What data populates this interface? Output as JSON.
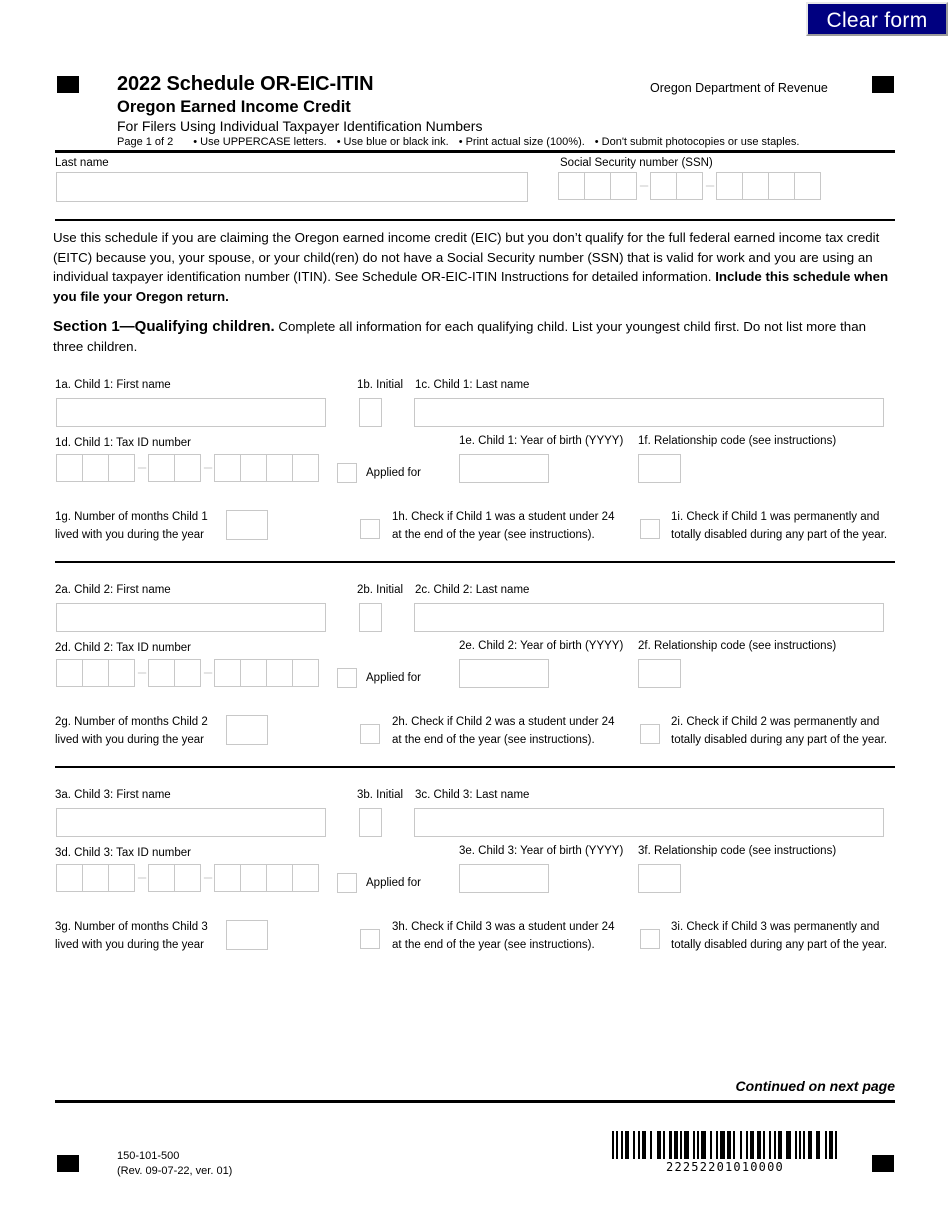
{
  "toolbar": {
    "clear_form_label": "Clear form",
    "clear_form_bg": "#000080",
    "clear_form_text_color": "#ffffff"
  },
  "header": {
    "title": "2022 Schedule OR-EIC-ITIN",
    "subtitle": "Oregon Earned Income Credit",
    "description": "For Filers Using Individual Taxpayer Identification Numbers",
    "agency": "Oregon Department of Revenue",
    "page_indicator": "Page 1 of 2",
    "instructions": [
      "Use UPPERCASE letters.",
      "Use blue or black ink.",
      "Print actual size (100%).",
      "Don't submit photocopies or use staples."
    ],
    "bullet": "•"
  },
  "taxpayer": {
    "last_name_label": "Last name",
    "last_name_value": "",
    "ssn_label": "Social Security number (SSN)",
    "ssn_groups": [
      3,
      2,
      4
    ],
    "ssn_separator": "–"
  },
  "intro": {
    "paragraph": "Use this schedule if you are claiming the Oregon earned income credit (EIC) but you don’t qualify for the full federal earned income tax credit (EITC) because you, your spouse, or your child(ren) do not have a Social Security number (SSN) that is valid for work and you are using an individual taxpayer identification number (ITIN). See Schedule OR-EIC-ITIN Instructions for detailed information.",
    "paragraph_bold": "Include this schedule when you file your Oregon return."
  },
  "section1": {
    "heading": "Section 1—Qualifying children.",
    "body": "Complete all information for each qualifying child. List your youngest child first. Do not list more than three children."
  },
  "children": [
    {
      "first_name_label": "1a. Child 1: First name",
      "first_name_value": "",
      "initial_label": "1b. Initial",
      "initial_value": "",
      "last_name_label": "1c. Child 1: Last name",
      "last_name_value": "",
      "tax_id_label": "1d. Child 1: Tax ID number",
      "tax_id_groups": [
        3,
        2,
        4
      ],
      "tax_id_separator": "–",
      "applied_for_label": "Applied for",
      "applied_for_checked": false,
      "year_of_birth_label": "1e. Child 1: Year of birth (YYYY)",
      "year_of_birth_value": "",
      "relationship_label": "1f. Relationship code (see instructions)",
      "relationship_value": "",
      "months_label_line1": "1g. Number of months Child 1",
      "months_label_line2": "lived with you during the year",
      "months_value": "",
      "student_label_line1": "1h. Check if Child 1 was a student under 24",
      "student_label_line2": "at the end of the year (see instructions).",
      "student_checked": false,
      "disabled_label_line1": "1i. Check if Child 1 was permanently and",
      "disabled_label_line2": "totally disabled during any part of the year.",
      "disabled_checked": false
    },
    {
      "first_name_label": "2a. Child 2: First name",
      "first_name_value": "",
      "initial_label": "2b. Initial",
      "initial_value": "",
      "last_name_label": "2c. Child 2: Last name",
      "last_name_value": "",
      "tax_id_label": "2d. Child 2: Tax ID number",
      "tax_id_groups": [
        3,
        2,
        4
      ],
      "tax_id_separator": "–",
      "applied_for_label": "Applied for",
      "applied_for_checked": false,
      "year_of_birth_label": "2e. Child 2: Year of birth (YYYY)",
      "year_of_birth_value": "",
      "relationship_label": "2f. Relationship code (see instructions)",
      "relationship_value": "",
      "months_label_line1": "2g. Number of months Child 2",
      "months_label_line2": "lived with you during the year",
      "months_value": "",
      "student_label_line1": "2h. Check if Child 2 was a student under 24",
      "student_label_line2": "at the end of the year (see instructions).",
      "student_checked": false,
      "disabled_label_line1": "2i. Check if Child 2 was permanently and",
      "disabled_label_line2": "totally disabled during any part of the year.",
      "disabled_checked": false
    },
    {
      "first_name_label": "3a. Child 3: First name",
      "first_name_value": "",
      "initial_label": "3b. Initial",
      "initial_value": "",
      "last_name_label": "3c. Child 3: Last name",
      "last_name_value": "",
      "tax_id_label": "3d. Child 3: Tax ID number",
      "tax_id_groups": [
        3,
        2,
        4
      ],
      "tax_id_separator": "–",
      "applied_for_label": "Applied for",
      "applied_for_checked": false,
      "year_of_birth_label": "3e. Child 3: Year of birth (YYYY)",
      "year_of_birth_value": "",
      "relationship_label": "3f. Relationship code (see instructions)",
      "relationship_value": "",
      "months_label_line1": "3g. Number of months Child 3",
      "months_label_line2": "lived with you during the year",
      "months_value": "",
      "student_label_line1": "3h. Check if Child 3 was a student under 24",
      "student_label_line2": "at the end of the year (see instructions).",
      "student_checked": false,
      "disabled_label_line1": "3i. Check if Child 3 was permanently and",
      "disabled_label_line2": "totally disabled during any part of the year.",
      "disabled_checked": false
    }
  ],
  "footer": {
    "continued": "Continued on next page",
    "form_number": "150-101-500",
    "revision": "(Rev. 09-07-22, ver. 01)",
    "barcode_digits": "22252201010000"
  }
}
